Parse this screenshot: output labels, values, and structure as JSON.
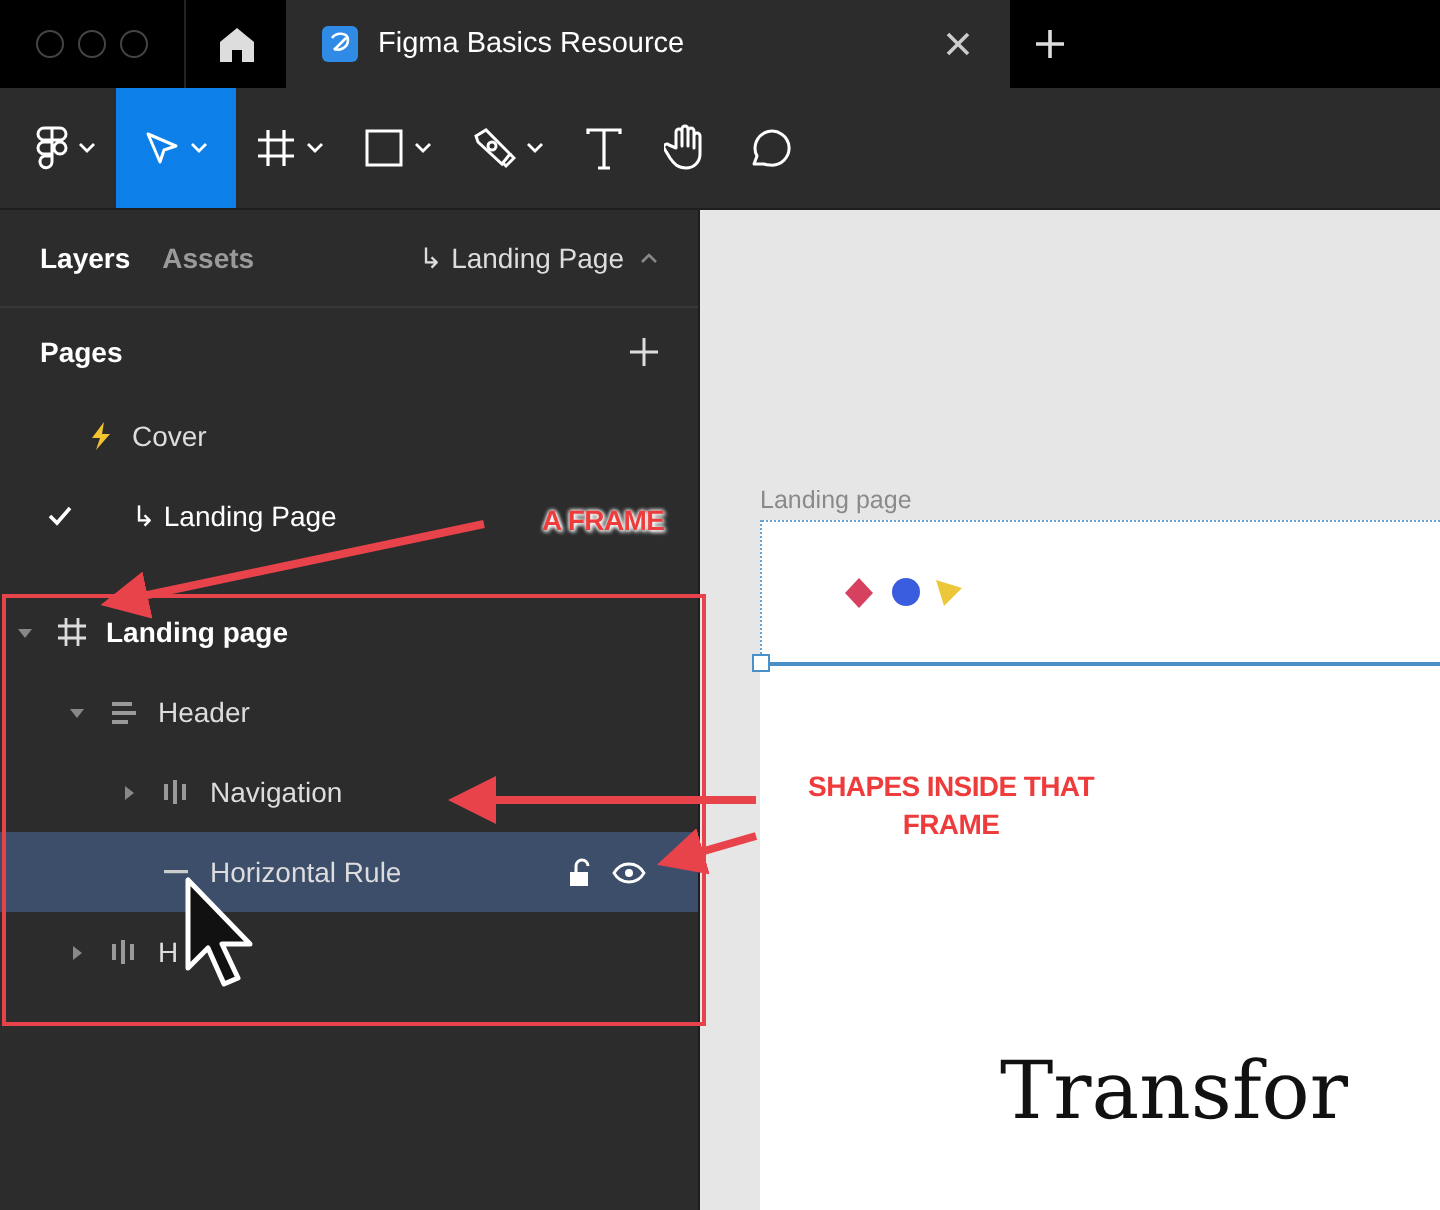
{
  "window": {
    "tabs": [
      {
        "title": "Figma Basics Resource",
        "selected": true
      }
    ]
  },
  "toolbar": {
    "tools": [
      {
        "kind": "menu",
        "selected": false
      },
      {
        "kind": "move",
        "selected": true
      },
      {
        "kind": "frame",
        "selected": false
      },
      {
        "kind": "shape",
        "selected": false
      },
      {
        "kind": "pen",
        "selected": false
      },
      {
        "kind": "text",
        "selected": false
      },
      {
        "kind": "hand",
        "selected": false
      },
      {
        "kind": "comment",
        "selected": false
      }
    ]
  },
  "sidebar": {
    "tabs": [
      {
        "label": "Layers",
        "selected": true
      },
      {
        "label": "Assets",
        "selected": false
      }
    ],
    "current_page": "↳ Landing Page",
    "pages_title": "Pages",
    "pages": [
      {
        "label": "Cover",
        "kind": "bolt",
        "selected": false
      },
      {
        "label": "↳ Landing Page",
        "kind": "plain",
        "selected": true
      }
    ],
    "layers": [
      {
        "name": "Landing page",
        "kind": "frame",
        "expanded": true,
        "selected": false,
        "children": [
          {
            "name": "Header",
            "kind": "vstack",
            "expanded": true,
            "selected": false,
            "children": [
              {
                "name": "Navigation",
                "kind": "hstack",
                "expanded": false,
                "selected": false
              },
              {
                "name": "Horizontal Rule",
                "kind": "line",
                "selected": true
              }
            ]
          },
          {
            "name": "H",
            "kind": "hstack",
            "expanded": false,
            "selected": false
          }
        ]
      }
    ]
  },
  "canvas": {
    "frame_label": "Landing page",
    "heading": "Transfor"
  },
  "annotations": [
    {
      "text": "A FRAME",
      "kind": "frame-note"
    },
    {
      "text": "SHAPES INSIDE THAT FRAME",
      "kind": "shapes-note"
    }
  ]
}
